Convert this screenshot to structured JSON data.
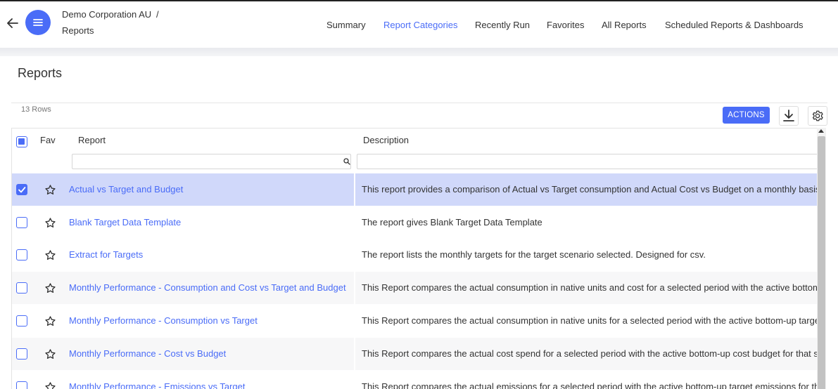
{
  "header": {
    "breadcrumb_company": "Demo Corporation AU",
    "breadcrumb_separator": "/",
    "breadcrumb_page": "Reports",
    "nav": [
      {
        "label": "Summary",
        "active": false
      },
      {
        "label": "Report Categories",
        "active": true
      },
      {
        "label": "Recently Run",
        "active": false
      },
      {
        "label": "Favorites",
        "active": false
      },
      {
        "label": "All Reports",
        "active": false
      },
      {
        "label": "Scheduled Reports & Dashboards",
        "active": false
      }
    ]
  },
  "page": {
    "title": "Reports",
    "row_count": "13 Rows",
    "actions_label": "ACTIONS"
  },
  "table": {
    "columns": {
      "fav": "Fav",
      "report": "Report",
      "description": "Description"
    },
    "filters": {
      "report_value": "",
      "description_value": ""
    },
    "rows": [
      {
        "report": "Actual vs Target and Budget",
        "description": "This report provides a comparison of Actual vs Target consumption and Actual Cost vs Budget on a monthly basis, t",
        "selected": true
      },
      {
        "report": "Blank Target Data Template",
        "description": "The report gives Blank Target Data Template",
        "selected": false
      },
      {
        "report": "Extract for Targets",
        "description": "The report lists the monthly targets for the target scenario selected. Designed for csv.",
        "selected": false
      },
      {
        "report": "Monthly Performance - Consumption and Cost vs Target and Budget",
        "description": "This Report compares the actual consumption in native units and cost for a selected period with the active bottom-u",
        "selected": false
      },
      {
        "report": "Monthly Performance - Consumption vs Target",
        "description": "This Report compares the actual consumption in native units for a selected period with the active bottom-up target",
        "selected": false
      },
      {
        "report": "Monthly Performance - Cost vs Budget",
        "description": "This Report compares the actual cost spend for a selected period with the active bottom-up cost budget for that sa",
        "selected": false
      },
      {
        "report": "Monthly Performance - Emissions vs Target",
        "description": "This Report compares the actual emissions for a selected period with the active bottom-up target emissions for that",
        "selected": false
      }
    ]
  },
  "colors": {
    "accent": "#4a6cf7",
    "selected_row": "#d0d8fa"
  },
  "icons": {
    "back": "arrow-left-icon",
    "menu": "hamburger-menu-icon",
    "download": "download-icon",
    "settings": "gear-icon",
    "search": "search-icon",
    "favorite": "star-outline-icon",
    "checkmark": "checkmark-icon"
  }
}
